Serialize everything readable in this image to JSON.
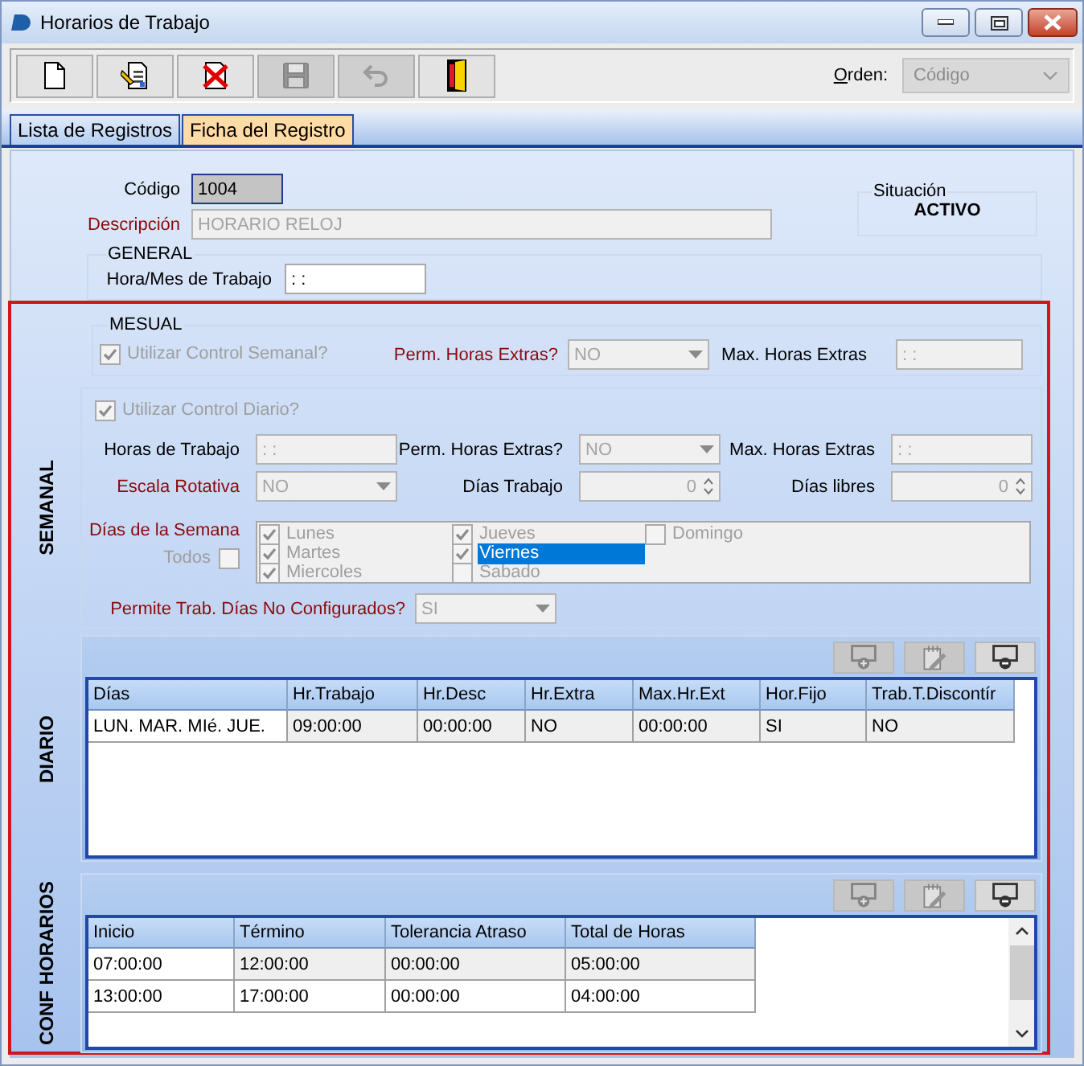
{
  "window": {
    "title": "Horarios de Trabajo",
    "controls": [
      {
        "kind": "minimize"
      },
      {
        "kind": "maximize"
      },
      {
        "kind": "close"
      }
    ]
  },
  "toolbar": {
    "buttons": [
      {
        "kind": "new",
        "disabled": false
      },
      {
        "kind": "edit",
        "disabled": false
      },
      {
        "kind": "delete",
        "disabled": false
      },
      {
        "kind": "save",
        "disabled": true
      },
      {
        "kind": "undo",
        "disabled": true
      },
      {
        "kind": "exit",
        "disabled": false
      }
    ],
    "order": {
      "label": "Orden:",
      "value": "Código",
      "disabled": true
    }
  },
  "tabs": [
    {
      "label": "Lista de Registros",
      "selected": false
    },
    {
      "label": "Ficha del Registro",
      "selected": true
    }
  ],
  "header": {
    "fields": [
      {
        "label": "Código",
        "value": "1004",
        "kind": "text",
        "required": false,
        "disabled": false,
        "focused": true
      },
      {
        "label": "Descripción",
        "value": "HORARIO RELOJ",
        "kind": "text",
        "required": true,
        "disabled": true,
        "focused": false
      }
    ],
    "status": {
      "label": "Situación",
      "value": "ACTIVO"
    }
  },
  "general": {
    "title": "GENERAL",
    "field": {
      "label": "Hora/Mes de Trabajo",
      "value": ": :",
      "kind": "text",
      "required": false,
      "disabled": false
    }
  },
  "mensual": {
    "title": "MESUAL",
    "checkbox": {
      "label": "Utilizar Control Semanal?",
      "checked": true,
      "disabled": true
    },
    "fields": [
      {
        "label": "Perm. Horas Extras?",
        "value": "NO",
        "kind": "combo",
        "required": true,
        "disabled": true
      },
      {
        "label": "Max. Horas Extras",
        "value": ": :",
        "kind": "text",
        "required": false,
        "disabled": true
      }
    ]
  },
  "semanal": {
    "title": "SEMANAL",
    "checkbox": {
      "label": "Utilizar Control Diario?",
      "checked": true,
      "disabled": true
    },
    "fields": [
      {
        "label": "Horas de Trabajo",
        "value": ": :",
        "kind": "text",
        "required": false,
        "disabled": true
      },
      {
        "label": "Perm. Horas Extras?",
        "value": "NO",
        "kind": "combo",
        "required": false,
        "disabled": true
      },
      {
        "label": "Max. Horas Extras",
        "value": ": :",
        "kind": "text",
        "required": false,
        "disabled": true
      },
      {
        "label": "Escala Rotativa",
        "value": "NO",
        "kind": "combo",
        "required": true,
        "disabled": true
      },
      {
        "label": "Días Trabajo",
        "value": "0",
        "kind": "spin",
        "required": false,
        "disabled": true
      },
      {
        "label": "Días libres",
        "value": "0",
        "kind": "spin",
        "required": false,
        "disabled": true
      }
    ],
    "days": {
      "label": "Días de la Semana",
      "required": true,
      "all": {
        "label": "Todos",
        "checked": false,
        "disabled": true
      },
      "items": [
        {
          "label": "Lunes",
          "checked": true,
          "selected": false,
          "disabled": true
        },
        {
          "label": "Martes",
          "checked": true,
          "selected": false,
          "disabled": true
        },
        {
          "label": "Miercoles",
          "checked": true,
          "selected": false,
          "disabled": true
        },
        {
          "label": "Jueves",
          "checked": true,
          "selected": false,
          "disabled": true
        },
        {
          "label": "Viernes",
          "checked": true,
          "selected": true,
          "disabled": true
        },
        {
          "label": "Sabado",
          "checked": false,
          "selected": false,
          "disabled": true
        },
        {
          "label": "Domingo",
          "checked": false,
          "selected": false,
          "disabled": true
        }
      ]
    },
    "permite": {
      "label": "Permite Trab. Días No Configurados?",
      "value": "SI",
      "kind": "combo",
      "required": true,
      "disabled": true
    }
  },
  "diario": {
    "title": "DIARIO",
    "buttons": [
      {
        "kind": "add",
        "disabled": true
      },
      {
        "kind": "edit",
        "disabled": true
      },
      {
        "kind": "remove",
        "disabled": false
      }
    ],
    "table": {
      "columns": [
        "Días",
        "Hr.Trabajo",
        "Hr.Desc",
        "Hr.Extra",
        "Max.Hr.Ext",
        "Hor.Fijo",
        "Trab.T.Discontír"
      ],
      "rows": [
        {
          "cells": [
            "LUN. MAR. MIé. JUE.",
            "09:00:00",
            "00:00:00",
            "NO",
            "00:00:00",
            "SI",
            "NO"
          ],
          "selected": true
        }
      ]
    }
  },
  "conf_horarios": {
    "title": "CONF HORARIOS",
    "buttons": [
      {
        "kind": "add",
        "disabled": true
      },
      {
        "kind": "edit",
        "disabled": true
      },
      {
        "kind": "remove",
        "disabled": false
      }
    ],
    "table": {
      "columns": [
        "Inicio",
        "Término",
        "Tolerancia Atraso",
        "Total de Horas"
      ],
      "rows": [
        {
          "cells": [
            "07:00:00",
            "12:00:00",
            "00:00:00",
            "05:00:00"
          ],
          "selected": true
        },
        {
          "cells": [
            "13:00:00",
            "17:00:00",
            "00:00:00",
            "04:00:00"
          ],
          "selected": false
        }
      ]
    }
  }
}
